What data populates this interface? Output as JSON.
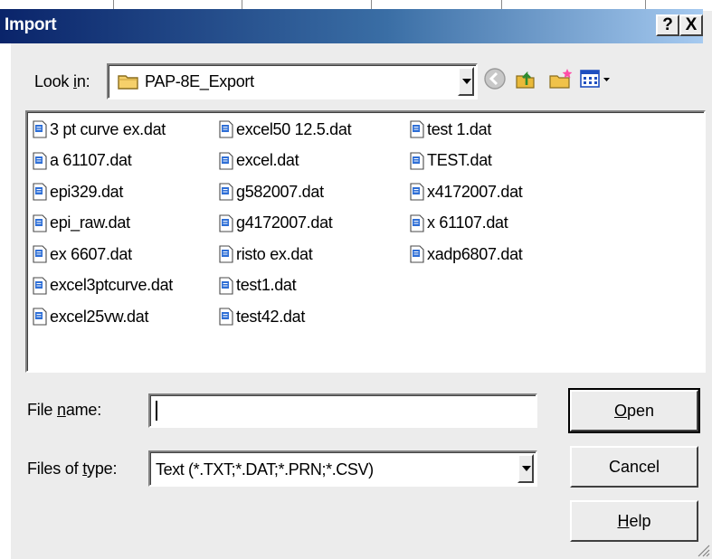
{
  "dialog": {
    "title": "Import",
    "help_glyph": "?",
    "close_glyph": "X"
  },
  "look_in": {
    "label_prefix": "Look ",
    "label_underlined": "i",
    "label_suffix": "n:",
    "folder": "PAP-8E_Export"
  },
  "files": {
    "columns": [
      [
        "3 pt curve ex.dat",
        "a 61107.dat",
        "epi329.dat",
        "epi_raw.dat",
        "ex 6607.dat",
        "excel3ptcurve.dat",
        "excel25vw.dat"
      ],
      [
        "excel50 12.5.dat",
        "excel.dat",
        "g582007.dat",
        "g4172007.dat",
        "risto ex.dat",
        "test1.dat",
        "test42.dat"
      ],
      [
        "test 1.dat",
        "TEST.dat",
        "x4172007.dat",
        "x 61107.dat",
        "xadp6807.dat"
      ]
    ]
  },
  "file_name": {
    "label_prefix": "File ",
    "label_underlined": "n",
    "label_suffix": "ame:",
    "value": ""
  },
  "file_type": {
    "label_prefix": "Files of ",
    "label_underlined": "t",
    "label_suffix": "ype:",
    "value": "Text (*.TXT;*.DAT;*.PRN;*.CSV)"
  },
  "buttons": {
    "open_underlined": "O",
    "open_rest": "pen",
    "cancel": "Cancel",
    "help_underlined": "H",
    "help_rest": "elp"
  },
  "colors": {
    "title_bar_start": "#0a246a",
    "title_bar_end": "#a6caf0",
    "dialog_face": "#ececec"
  },
  "icons": {
    "back": "back-arrow-icon",
    "up": "up-folder-icon",
    "new_folder": "new-folder-icon",
    "view_menu": "view-menu-icon",
    "file": "data-file-icon",
    "folder": "folder-icon"
  }
}
